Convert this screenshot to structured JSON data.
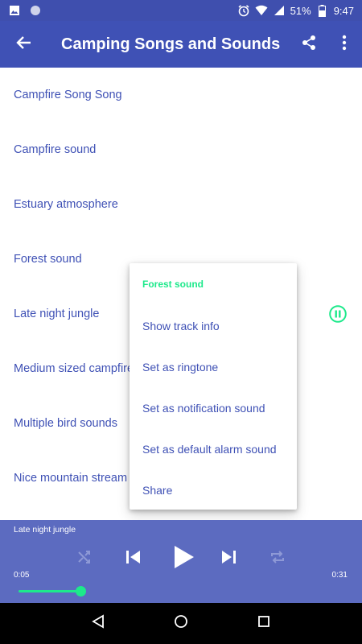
{
  "status_bar": {
    "battery": "51%",
    "time": "9:47",
    "icons": [
      "image-icon",
      "circle-icon",
      "alarm-icon",
      "wifi-icon",
      "signal-icon",
      "battery-icon"
    ]
  },
  "app_bar": {
    "title": "Camping Songs and Sounds",
    "icons": [
      "back-arrow-icon",
      "share-icon",
      "more-vert-icon"
    ]
  },
  "sounds": [
    {
      "label": "Campfire Song Song"
    },
    {
      "label": "Campfire sound"
    },
    {
      "label": "Estuary atmosphere"
    },
    {
      "label": "Forest sound"
    },
    {
      "label": "Late night jungle"
    },
    {
      "label": "Medium sized campfire"
    },
    {
      "label": "Multiple bird sounds"
    },
    {
      "label": "Nice mountain stream"
    }
  ],
  "popup_menu": {
    "header": "Forest sound",
    "items": [
      {
        "label": "Show track info"
      },
      {
        "label": "Set as ringtone"
      },
      {
        "label": "Set as notification sound"
      },
      {
        "label": "Set as default alarm sound"
      },
      {
        "label": "Share"
      }
    ]
  },
  "player": {
    "track": "Late night jungle",
    "elapsed": "0:05",
    "duration": "0:31",
    "progress": 0.16,
    "icons": [
      "shuffle-icon",
      "skip-previous-icon",
      "play-icon",
      "skip-next-icon",
      "repeat-icon"
    ]
  },
  "colors": {
    "primary": "#3f51b5",
    "primary_dark": "#3f4fae",
    "player_bg": "#5c6bc0",
    "accent": "#1de98b"
  }
}
